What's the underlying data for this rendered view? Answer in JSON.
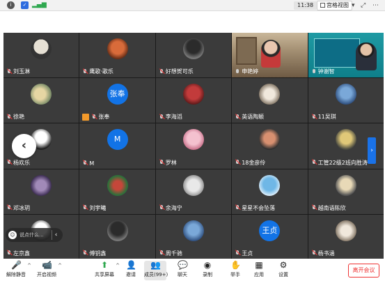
{
  "status_bar": {
    "icons": [
      "info-icon",
      "shield-icon",
      "signal-icon"
    ],
    "clock": "11:38",
    "view_mode_label": "宫格视图",
    "view_icons": [
      "chevron-down-icon",
      "fullscreen-icon",
      "more-icon"
    ]
  },
  "participants": [
    {
      "name": "刘玉淋",
      "avatar": "photo"
    },
    {
      "name": "鹰歌·歌乐",
      "avatar": "photo"
    },
    {
      "name": "好想贺可乐",
      "avatar": "photo"
    },
    {
      "name": "申艳婷",
      "avatar": "video",
      "mic": "on"
    },
    {
      "name": "钟谢智",
      "avatar": "video",
      "mic": "on"
    },
    {
      "name": "徐艳",
      "avatar": "photo"
    },
    {
      "name": "张奉",
      "avatar": "text",
      "avatar_text": "张奉",
      "host": true
    },
    {
      "name": "李海滔",
      "avatar": "photo"
    },
    {
      "name": "英语陶颖",
      "avatar": "photo"
    },
    {
      "name": "11吴琪",
      "avatar": "photo"
    },
    {
      "name": "杨欢乐",
      "avatar": "photo"
    },
    {
      "name": "M",
      "avatar": "text",
      "avatar_text": "M"
    },
    {
      "name": "罗林",
      "avatar": "photo"
    },
    {
      "name": "18金彦伶",
      "avatar": "photo"
    },
    {
      "name": "工管22级2班向胜涛",
      "avatar": "photo"
    },
    {
      "name": "邓冰玥",
      "avatar": "photo"
    },
    {
      "name": "刘宇曦",
      "avatar": "photo"
    },
    {
      "name": "余海宁",
      "avatar": "photo"
    },
    {
      "name": "星星不会坠落",
      "avatar": "photo"
    },
    {
      "name": "越南语陈欣",
      "avatar": "photo"
    },
    {
      "name": "左京鑫",
      "avatar": "photo"
    },
    {
      "name": "傅钥鑫",
      "avatar": "photo"
    },
    {
      "name": "周千驰",
      "avatar": "photo"
    },
    {
      "name": "王贞",
      "avatar": "text",
      "avatar_text": "王贞"
    },
    {
      "name": "杨书涵",
      "avatar": "photo"
    }
  ],
  "chat": {
    "placeholder": "说点什么...",
    "chevron": "‹"
  },
  "toolbar": {
    "unmute": "解除静音",
    "start_video": "开启视频",
    "share_screen": "共享屏幕",
    "invite": "邀请",
    "members": "成员(99+)",
    "chat": "聊天",
    "record": "录制",
    "raise_hand": "举手",
    "apps": "应用",
    "settings": "设置",
    "leave": "离开会议"
  },
  "colors": {
    "accent": "#1273e6",
    "danger": "#e33333",
    "tile_bg": "#3b3b3b"
  }
}
